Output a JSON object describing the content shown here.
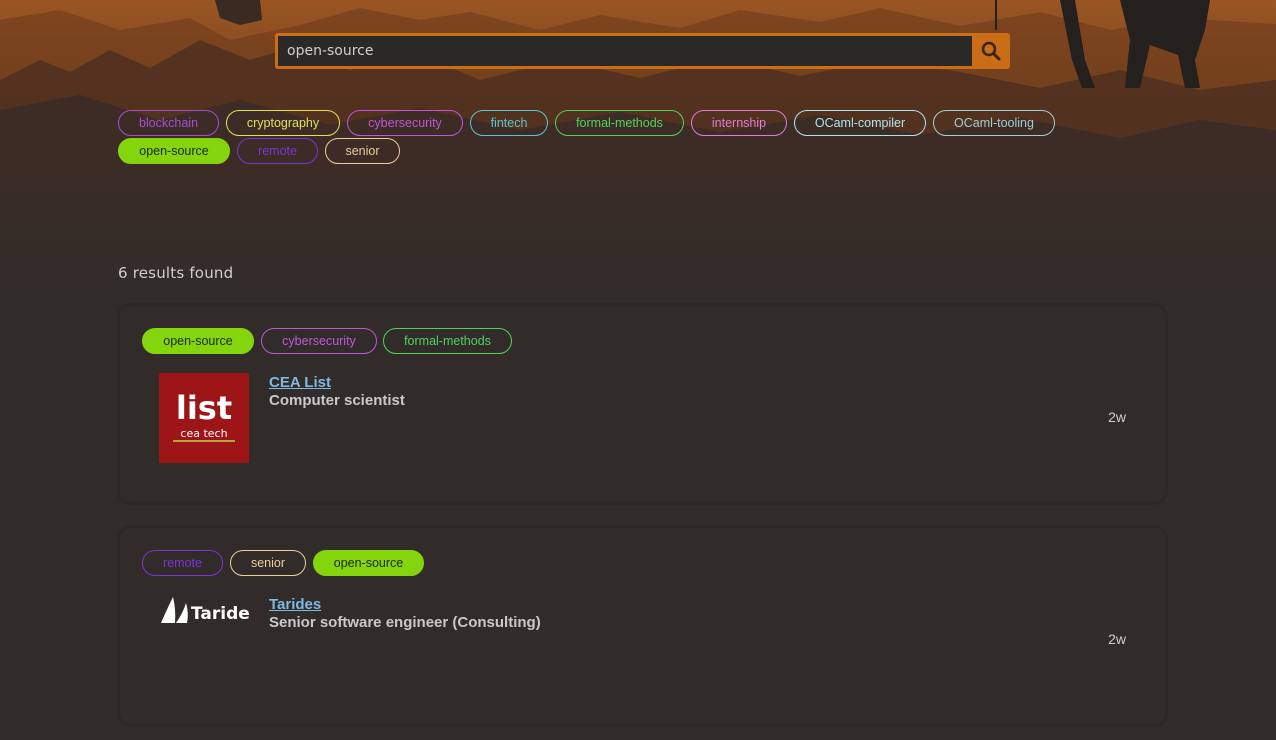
{
  "search": {
    "value": "open-source",
    "icon": "search-icon"
  },
  "filters": [
    {
      "label": "blockchain",
      "active": false
    },
    {
      "label": "cryptography",
      "active": false
    },
    {
      "label": "cybersecurity",
      "active": false
    },
    {
      "label": "fintech",
      "active": false
    },
    {
      "label": "formal-methods",
      "active": false
    },
    {
      "label": "internship",
      "active": false
    },
    {
      "label": "OCaml-compiler",
      "active": false
    },
    {
      "label": "OCaml-tooling",
      "active": false
    },
    {
      "label": "open-source",
      "active": true
    },
    {
      "label": "remote",
      "active": false
    },
    {
      "label": "senior",
      "active": false
    }
  ],
  "results": {
    "count_label": "6 results found"
  },
  "jobs": [
    {
      "tags": [
        "open-source",
        "cybersecurity",
        "formal-methods"
      ],
      "company": "CEA List",
      "title": "Computer scientist",
      "age": "2w",
      "logo": {
        "line1": "list",
        "line2": "cea tech",
        "bg": "#b01a1a"
      }
    },
    {
      "tags": [
        "remote",
        "senior",
        "open-source"
      ],
      "company": "Tarides",
      "title": "Senior software engineer (Consulting)",
      "age": "2w",
      "logo": {
        "text": "Tarides"
      }
    }
  ],
  "colors": {
    "accent": "#c96e17",
    "active_tag": "#84d40e",
    "link": "#7fb8e0",
    "background": "#312c2a"
  }
}
